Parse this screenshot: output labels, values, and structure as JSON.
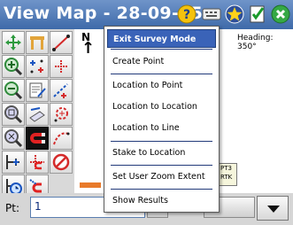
{
  "title_bar": {
    "title": "View Map - 28-09-15",
    "icons": [
      "help-icon",
      "keyboard-icon",
      "favorites-star-icon",
      "checklist-icon",
      "close-icon"
    ]
  },
  "map": {
    "north_label": "N",
    "north_arrow": "↑",
    "heading": "Heading: 350°",
    "status_box": [
      "PT3",
      "RTK"
    ]
  },
  "context_menu": {
    "items": [
      {
        "label": "Exit Survey Mode",
        "selected": true
      },
      {
        "label": "Create Point"
      },
      {
        "label": "Location to Point"
      },
      {
        "label": "Location to Location"
      },
      {
        "label": "Location to Line"
      },
      {
        "label": "Stake to Location"
      },
      {
        "label": "Set User Zoom Extent"
      },
      {
        "label": "Show Results"
      }
    ]
  },
  "bottom_bar": {
    "point_label": "Pt:",
    "point_value": "1"
  },
  "colors": {
    "titlebar": "#4a76b5",
    "menu_selected": "#3a63b8",
    "scale_bar": "#e87a2a"
  }
}
